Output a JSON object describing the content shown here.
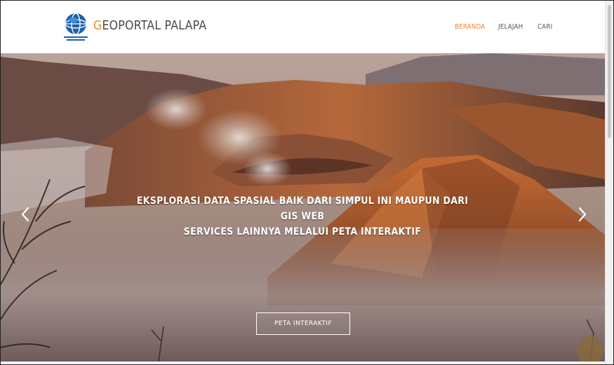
{
  "header": {
    "logo_small_text": "BADAN INFORMASI GEOSPASIAL",
    "title_first": "G",
    "title_rest": "EOPORTAL PALAPA",
    "nav": [
      {
        "label": "BERANDA",
        "active": true
      },
      {
        "label": "JELAJAH",
        "active": false
      },
      {
        "label": "CARI",
        "active": false
      }
    ]
  },
  "hero": {
    "line1": "EKSPLORASI DATA SPASIAL BAIK DARI SIMPUL INI MAUPUN DARI GIS WEB",
    "line2": "SERVICES LAINNYA MELALUI PETA INTERAKTIF",
    "button_label": "PETA INTERAKTIF",
    "prev_icon": "chevron-left-icon",
    "next_icon": "chevron-right-icon"
  },
  "colors": {
    "accent": "#f0822a",
    "title_text": "#4a4a4a",
    "globe_blue": "#1f5fa8"
  }
}
